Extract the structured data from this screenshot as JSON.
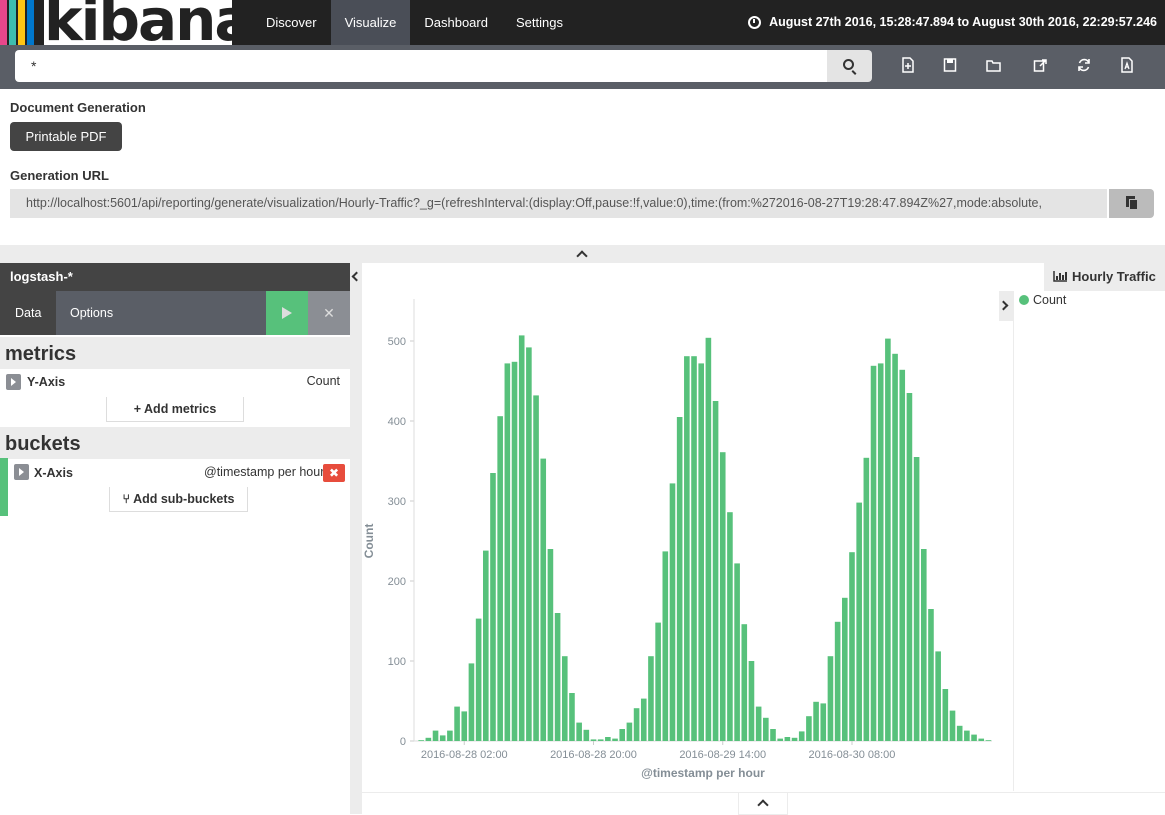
{
  "app": {
    "logo_text": "kibana",
    "logo_colors": [
      "#e8478b",
      "#3ebeb0",
      "#fec514",
      "#0077cc"
    ],
    "nav": [
      {
        "label": "Discover"
      },
      {
        "label": "Visualize",
        "active": true
      },
      {
        "label": "Dashboard"
      },
      {
        "label": "Settings"
      }
    ],
    "timerange": "August 27th 2016, 15:28:47.894 to August 30th 2016, 22:29:57.246"
  },
  "search": {
    "value": "*",
    "tools": [
      "new-icon",
      "save-icon",
      "open-icon",
      "share-icon",
      "refresh-icon",
      "pdf-icon"
    ]
  },
  "reporting": {
    "doc_gen_label": "Document Generation",
    "pdf_button": "Printable PDF",
    "url_label": "Generation URL",
    "url": "http://localhost:5601/api/reporting/generate/visualization/Hourly-Traffic?_g=(refreshInterval:(display:Off,pause:!f,value:0),time:(from:%272016-08-27T19:28:47.894Z%27,mode:absolute,"
  },
  "sidebar": {
    "index": "logstash-*",
    "tabs": [
      {
        "label": "Data",
        "active": true
      },
      {
        "label": "Options"
      }
    ],
    "close_glyph": "✕",
    "metrics_title": "metrics",
    "y_axis_label": "Y-Axis",
    "y_axis_value": "Count",
    "add_metrics": "Add metrics",
    "add_metrics_glyph": "+",
    "buckets_title": "buckets",
    "x_axis_label": "X-Axis",
    "x_axis_value": "@timestamp per hour",
    "delete_glyph": "✖",
    "add_sub_buckets": "Add sub-buckets",
    "add_sub_buckets_glyph": "⑂"
  },
  "legend": {
    "title": "Hourly Traffic",
    "items": [
      {
        "label": "Count",
        "color": "#57c17b"
      }
    ]
  },
  "chart_data": {
    "type": "bar",
    "xlabel": "@timestamp per hour",
    "ylabel": "Count",
    "ylim": [
      0,
      550
    ],
    "yticks": [
      0,
      100,
      200,
      300,
      400,
      500
    ],
    "x_ticks": [
      {
        "label": "2016-08-28 02:00",
        "index": 6
      },
      {
        "label": "2016-08-28 20:00",
        "index": 24
      },
      {
        "label": "2016-08-29 14:00",
        "index": 42
      },
      {
        "label": "2016-08-30 08:00",
        "index": 60
      }
    ],
    "x_start": "2016-08-27 20:00",
    "x_interval": "1 hour",
    "color": "#57c17b",
    "series": [
      {
        "name": "Count",
        "values": [
          1,
          4,
          13,
          7,
          13,
          43,
          37,
          97,
          153,
          238,
          335,
          406,
          472,
          474,
          507,
          492,
          432,
          353,
          240,
          160,
          106,
          60,
          23,
          14,
          2,
          2,
          5,
          3,
          15,
          23,
          41,
          53,
          106,
          148,
          237,
          322,
          405,
          481,
          481,
          472,
          504,
          425,
          361,
          286,
          222,
          146,
          100,
          43,
          29,
          15,
          3,
          5,
          4,
          12,
          31,
          49,
          47,
          106,
          149,
          179,
          236,
          298,
          354,
          469,
          472,
          503,
          484,
          464,
          435,
          355,
          240,
          165,
          112,
          65,
          38,
          19,
          13,
          8,
          3,
          1
        ]
      }
    ]
  }
}
